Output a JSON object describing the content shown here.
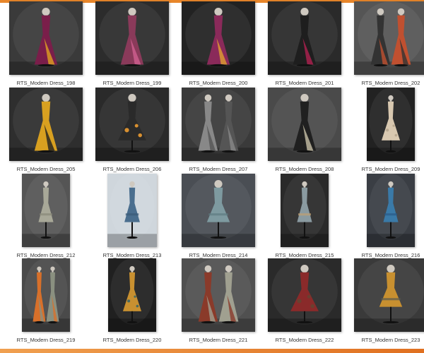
{
  "accent_color": "#e8862a",
  "items": [
    {
      "label": "RTS_Modern Dress_198",
      "icon": "dress-image"
    },
    {
      "label": "RTS_Modern Dress_199",
      "icon": "dress-image"
    },
    {
      "label": "RTS_Modern Dress_200",
      "icon": "dress-image"
    },
    {
      "label": "RTS_Modern Dress_201",
      "icon": "dress-image"
    },
    {
      "label": "RTS_Modern Dress_202",
      "icon": "dress-image"
    },
    {
      "label": "RTS_Modern Dress_205",
      "icon": "dress-image"
    },
    {
      "label": "RTS_Modern Dress_206",
      "icon": "dress-image"
    },
    {
      "label": "RTS_Modern Dress_207",
      "icon": "dress-image"
    },
    {
      "label": "RTS_Modern Dress_208",
      "icon": "dress-image"
    },
    {
      "label": "RTS_Modern Dress_209",
      "icon": "dress-image"
    },
    {
      "label": "RTS_Modern Dress_212",
      "icon": "dress-image"
    },
    {
      "label": "RTS_Modern Dress_213",
      "icon": "dress-image"
    },
    {
      "label": "RTS_Modern Dress_214",
      "icon": "dress-image"
    },
    {
      "label": "RTS_Modern Dress_215",
      "icon": "dress-image"
    },
    {
      "label": "RTS_Modern Dress_216",
      "icon": "dress-image"
    },
    {
      "label": "RTS_Modern Dress_219",
      "icon": "dress-image"
    },
    {
      "label": "RTS_Modern Dress_220",
      "icon": "dress-image"
    },
    {
      "label": "RTS_Modern Dress_221",
      "icon": "dress-image"
    },
    {
      "label": "RTS_Modern Dress_222",
      "icon": "dress-image"
    },
    {
      "label": "RTS_Modern Dress_223",
      "icon": "dress-image"
    }
  ]
}
